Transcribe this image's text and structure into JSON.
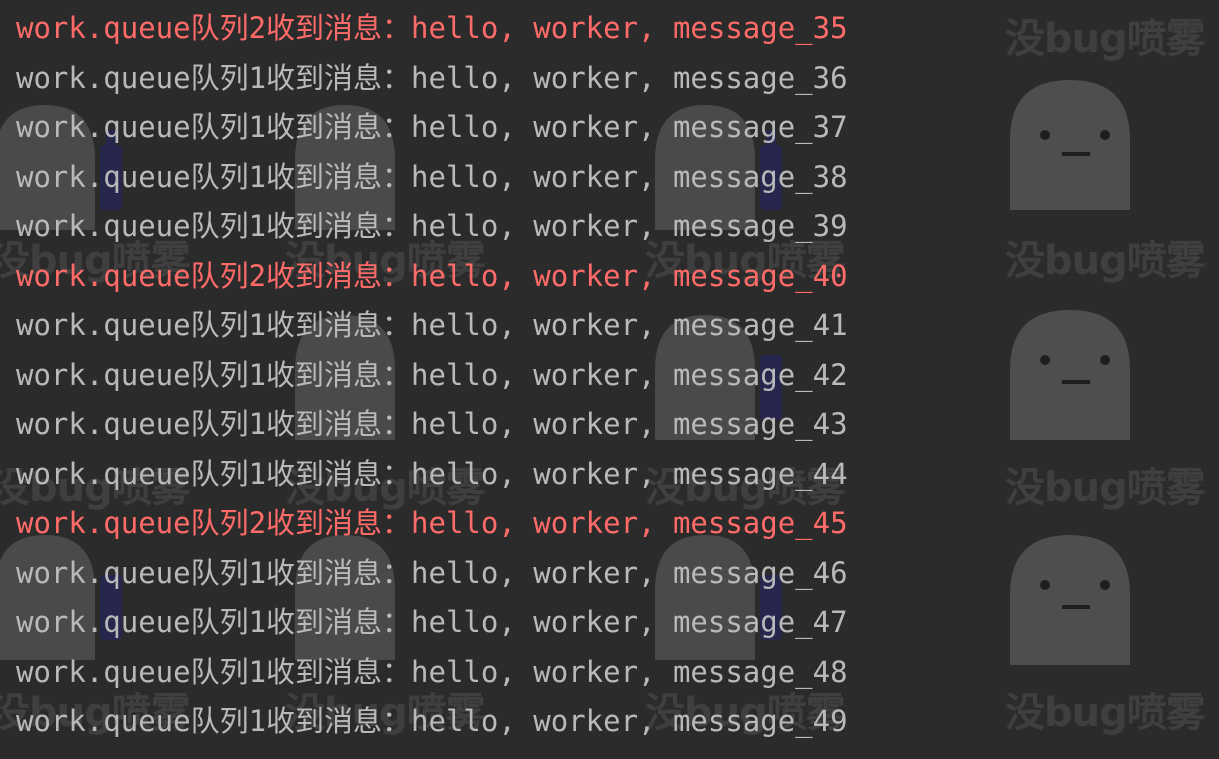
{
  "watermark": {
    "text": "没bug喷雾",
    "icon": "ghost-with-spray-bottle-icon"
  },
  "colors": {
    "background": "#2b2b2b",
    "stdout_text": "#b9b9b9",
    "stderr_text": "#ff6b68"
  },
  "console": {
    "lines": [
      {
        "text": "work.queue队列2收到消息：hello, worker, message_35",
        "stream": "stderr"
      },
      {
        "text": "work.queue队列1收到消息：hello, worker, message_36",
        "stream": "stdout"
      },
      {
        "text": "work.queue队列1收到消息：hello, worker, message_37",
        "stream": "stdout"
      },
      {
        "text": "work.queue队列1收到消息：hello, worker, message_38",
        "stream": "stdout"
      },
      {
        "text": "work.queue队列1收到消息：hello, worker, message_39",
        "stream": "stdout"
      },
      {
        "text": "work.queue队列2收到消息：hello, worker, message_40",
        "stream": "stderr"
      },
      {
        "text": "work.queue队列1收到消息：hello, worker, message_41",
        "stream": "stdout"
      },
      {
        "text": "work.queue队列1收到消息：hello, worker, message_42",
        "stream": "stdout"
      },
      {
        "text": "work.queue队列1收到消息：hello, worker, message_43",
        "stream": "stdout"
      },
      {
        "text": "work.queue队列1收到消息：hello, worker, message_44",
        "stream": "stdout"
      },
      {
        "text": "work.queue队列2收到消息：hello, worker, message_45",
        "stream": "stderr"
      },
      {
        "text": "work.queue队列1收到消息：hello, worker, message_46",
        "stream": "stdout"
      },
      {
        "text": "work.queue队列1收到消息：hello, worker, message_47",
        "stream": "stdout"
      },
      {
        "text": "work.queue队列1收到消息：hello, worker, message_48",
        "stream": "stdout"
      },
      {
        "text": "work.queue队列1收到消息：hello, worker, message_49",
        "stream": "stdout"
      }
    ]
  }
}
